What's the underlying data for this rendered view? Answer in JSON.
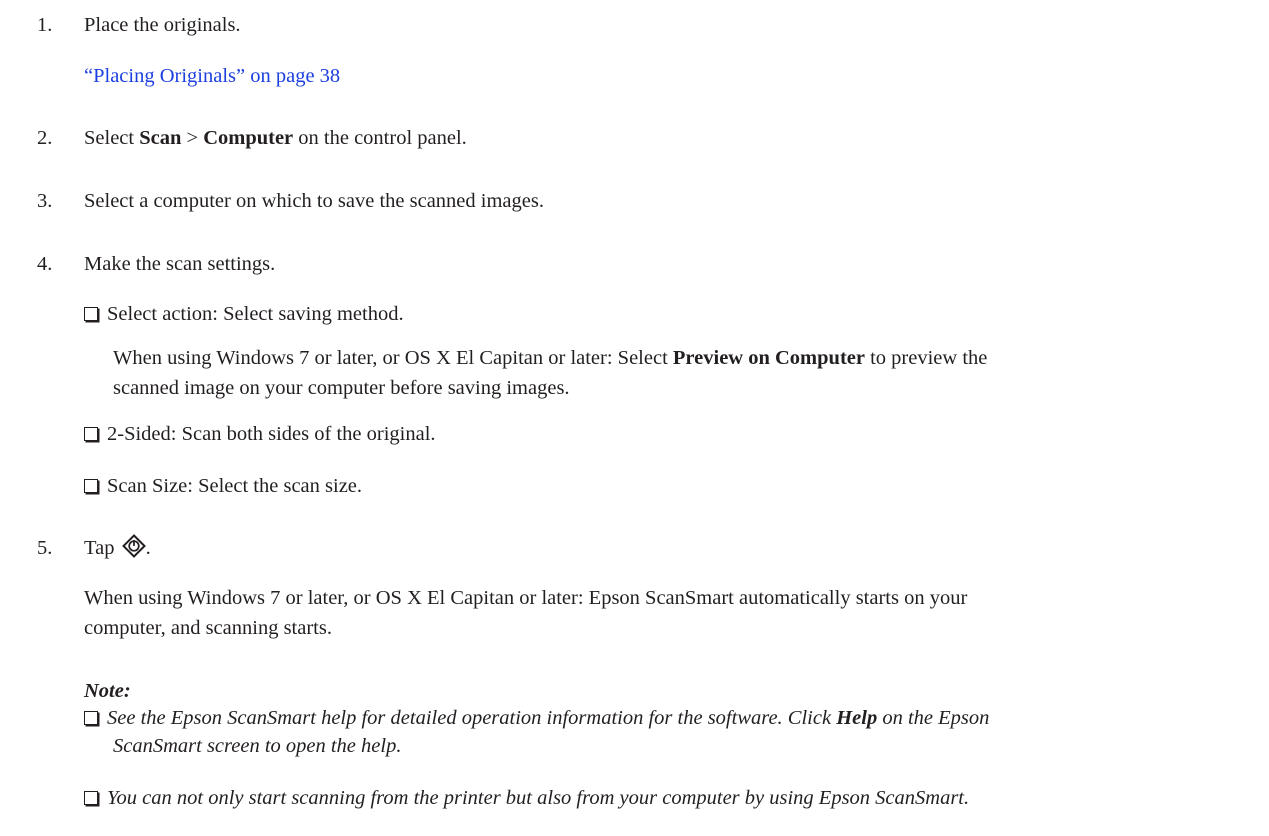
{
  "steps": [
    {
      "num": "1.",
      "text": "Place the originals."
    },
    {
      "num": "2.",
      "pre": "Select ",
      "b1": "Scan",
      "mid": " > ",
      "b2": "Computer",
      "post": " on the control panel."
    },
    {
      "num": "3.",
      "text": "Select a computer on which to save the scanned images."
    },
    {
      "num": "4.",
      "text": "Make the scan settings."
    },
    {
      "num": "5.",
      "pre": "Tap ",
      "post": "."
    }
  ],
  "link_text": "“Placing Originals” on page 38",
  "settings": {
    "action": "Select action: Select saving method.",
    "action_detail_pre": "When using Windows 7 or later, or OS X El Capitan or later: Select ",
    "action_detail_bold": "Preview on Computer",
    "action_detail_post1": " to preview the",
    "action_detail_line2": "scanned image on your computer before saving images.",
    "two_sided": "2-Sided: Scan both sides of the original.",
    "scan_size": "Scan Size: Select the scan size."
  },
  "step5_detail_line1": "When using Windows 7 or later, or OS X El Capitan or later: Epson ScanSmart automatically starts on your",
  "step5_detail_line2": "computer, and scanning starts.",
  "note": {
    "heading": "Note:",
    "item1_pre": "See the Epson ScanSmart help for detailed operation information for the software. Click ",
    "item1_bold": "Help",
    "item1_post": " on the Epson",
    "item1_line2": "ScanSmart screen to open the help.",
    "item2": "You can not only start scanning from the printer but also from your computer by using Epson ScanSmart."
  },
  "icons": {
    "start": "start-diamond-icon"
  }
}
